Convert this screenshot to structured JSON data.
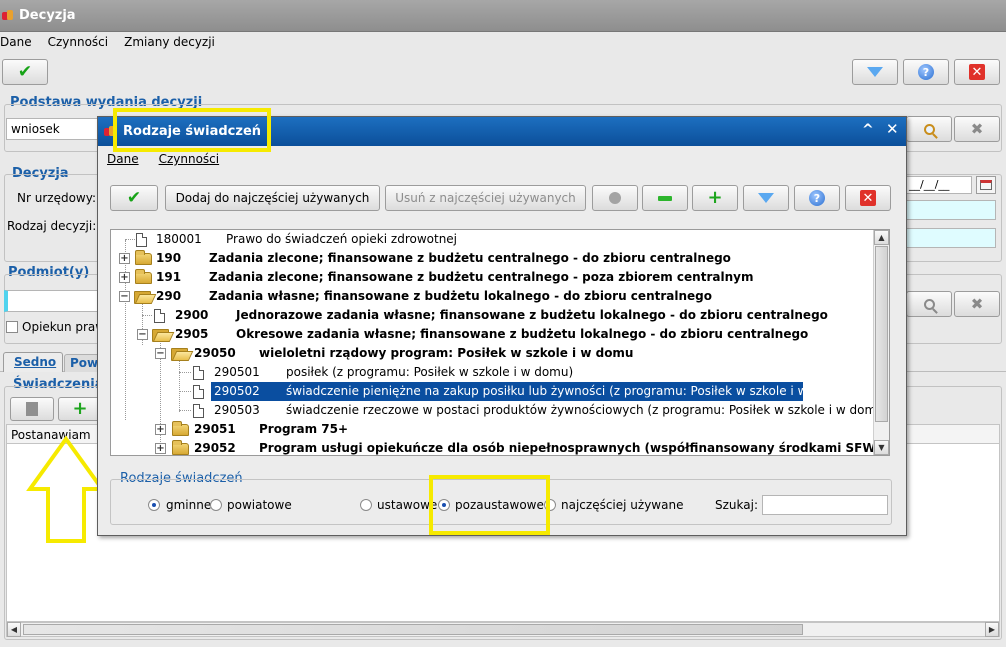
{
  "main": {
    "title": "Decyzja",
    "menu": [
      "Dane",
      "Czynności",
      "Zmiany decyzji"
    ],
    "podstawa_title": "Podstawa wydania decyzji",
    "podstawa_value": "wniosek",
    "decyzja_title": "Decyzja",
    "nr_urzedowy_label": "Nr urzędowy:",
    "rodzaj_decyzji_label": "Rodzaj decyzji:",
    "date_placeholder": "__/__/__",
    "podmioty_title": "Podmiot(y)",
    "opiekun_label": "Opiekun praw",
    "tabs": [
      "Sedno",
      "Pow"
    ],
    "swiadczenia_title": "Świadczenia",
    "column_header": "Postanawiam"
  },
  "dialog": {
    "title": "Rodzaje świadczeń",
    "menu": [
      "Dane",
      "Czynności"
    ],
    "toolbar": {
      "add_favorite": "Dodaj do najczęściej używanych",
      "remove_favorite": "Usuń z najczęściej używanych"
    },
    "tree": [
      {
        "code": "180001",
        "desc": "Prawo do świadczeń opieki zdrowotnej",
        "bold": false
      },
      {
        "code": "190",
        "desc": "Zadania zlecone; finansowane z budżetu centralnego - do zbioru centralnego",
        "bold": true
      },
      {
        "code": "191",
        "desc": "Zadania zlecone; finansowane z budżetu centralnego -  poza zbiorem centralnym",
        "bold": true
      },
      {
        "code": "290",
        "desc": "Zadania własne; finansowane z budżetu lokalnego - do zbioru centralnego",
        "bold": true
      },
      {
        "code": "2900",
        "desc": "Jednorazowe zadania własne; finansowane z budżetu lokalnego - do zbioru centralnego",
        "bold": true
      },
      {
        "code": "2905",
        "desc": "Okresowe zadania własne; finansowane z budżetu lokalnego - do zbioru centralnego",
        "bold": true
      },
      {
        "code": "29050",
        "desc": "wieloletni rządowy program: Posiłek w szkole i w domu",
        "bold": true
      },
      {
        "code": "290501",
        "desc": "posiłek (z programu: Posiłek w szkole i w domu)",
        "bold": false
      },
      {
        "code": "290502",
        "desc": "świadczenie pieniężne na zakup posiłku lub żywności (z programu: Posiłek w szkole i w domu)",
        "bold": false
      },
      {
        "code": "290503",
        "desc": "świadczenie rzeczowe w postaci produktów żywnościowych (z programu: Posiłek w szkole i w domu)",
        "bold": false
      },
      {
        "code": "29051",
        "desc": "Program 75+",
        "bold": true
      },
      {
        "code": "29052",
        "desc": "Program usługi opiekuńcze dla osób niepełnosprawnych (współfinansowany środkami SFWON)",
        "bold": true
      }
    ],
    "filter": {
      "title": "Rodzaje świadczeń",
      "options": [
        "gminne",
        "powiatowe",
        "ustawowe",
        "pozaustawowe",
        "najczęściej używane"
      ],
      "search_label": "Szukaj:"
    }
  }
}
